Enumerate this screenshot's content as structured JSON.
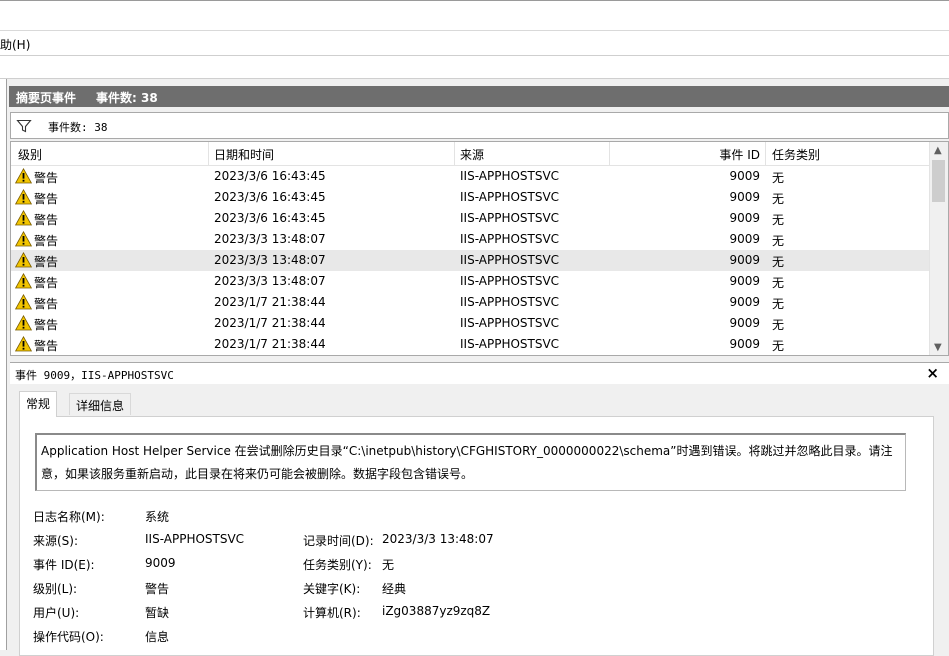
{
  "menu": {
    "help_label": "助(H)"
  },
  "summary": {
    "title": "摘要页事件",
    "count_label": "事件数: 38"
  },
  "filter": {
    "count_label": "事件数: 38",
    "icon": "filter-icon"
  },
  "table": {
    "columns": [
      "级别",
      "日期和时间",
      "来源",
      "事件 ID",
      "任务类别"
    ],
    "rows": [
      {
        "level": "警告",
        "datetime": "2023/3/6 16:43:45",
        "source": "IIS-APPHOSTSVC",
        "event_id": "9009",
        "task": "无"
      },
      {
        "level": "警告",
        "datetime": "2023/3/6 16:43:45",
        "source": "IIS-APPHOSTSVC",
        "event_id": "9009",
        "task": "无"
      },
      {
        "level": "警告",
        "datetime": "2023/3/6 16:43:45",
        "source": "IIS-APPHOSTSVC",
        "event_id": "9009",
        "task": "无"
      },
      {
        "level": "警告",
        "datetime": "2023/3/3 13:48:07",
        "source": "IIS-APPHOSTSVC",
        "event_id": "9009",
        "task": "无"
      },
      {
        "level": "警告",
        "datetime": "2023/3/3 13:48:07",
        "source": "IIS-APPHOSTSVC",
        "event_id": "9009",
        "task": "无",
        "selected": true
      },
      {
        "level": "警告",
        "datetime": "2023/3/3 13:48:07",
        "source": "IIS-APPHOSTSVC",
        "event_id": "9009",
        "task": "无"
      },
      {
        "level": "警告",
        "datetime": "2023/1/7 21:38:44",
        "source": "IIS-APPHOSTSVC",
        "event_id": "9009",
        "task": "无"
      },
      {
        "level": "警告",
        "datetime": "2023/1/7 21:38:44",
        "source": "IIS-APPHOSTSVC",
        "event_id": "9009",
        "task": "无"
      },
      {
        "level": "警告",
        "datetime": "2023/1/7 21:38:44",
        "source": "IIS-APPHOSTSVC",
        "event_id": "9009",
        "task": "无"
      }
    ]
  },
  "detail": {
    "title": "事件 9009，IIS-APPHOSTSVC",
    "close_label": "×",
    "tabs": [
      "常规",
      "详细信息"
    ],
    "message": "Application Host Helper Service 在尝试删除历史目录“C:\\inetpub\\history\\CFGHISTORY_0000000022\\schema”时遇到错误。将跳过并忽略此目录。请注意，如果该服务重新启动，此目录在将来仍可能会被删除。数据字段包含错误号。",
    "fields": {
      "log_name_label": "日志名称(M):",
      "log_name": "系统",
      "source_label": "来源(S):",
      "source": "IIS-APPHOSTSVC",
      "logged_label": "记录时间(D):",
      "logged": "2023/3/3 13:48:07",
      "event_id_label": "事件 ID(E):",
      "event_id": "9009",
      "task_label": "任务类别(Y):",
      "task": "无",
      "level_label": "级别(L):",
      "level": "警告",
      "keywords_label": "关键字(K):",
      "keywords": "经典",
      "user_label": "用户(U):",
      "user": "暂缺",
      "computer_label": "计算机(R):",
      "computer": "iZg03887yz9zq8Z",
      "opcode_label": "操作代码(O):",
      "opcode": "信息"
    }
  },
  "colors": {
    "warning": "#f2c500",
    "header_bg": "#6e6e6e",
    "selected_row": "#e8e8e8"
  }
}
